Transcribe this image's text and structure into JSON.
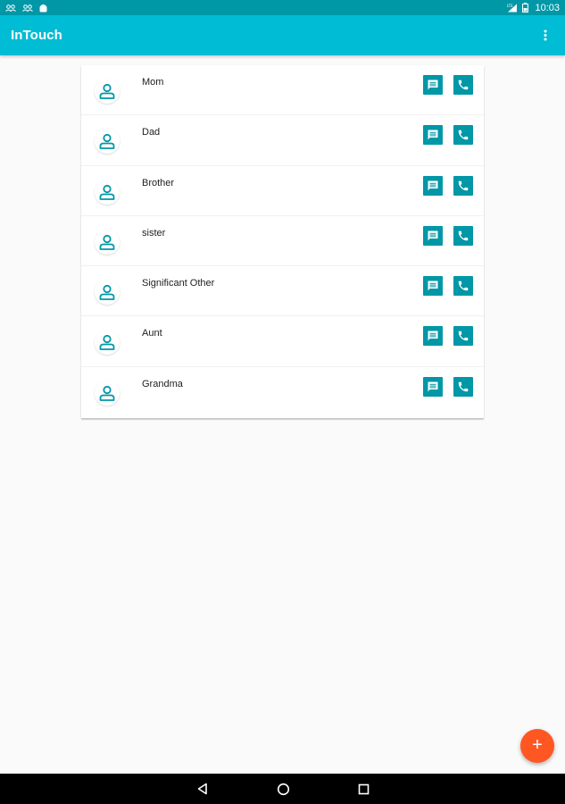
{
  "status_bar": {
    "time": "10:03",
    "network": "LTE",
    "left_icons": [
      "contacts-sync-icon",
      "contacts-sync-icon",
      "android-icon"
    ],
    "right_icons": [
      "signal-icon",
      "battery-icon"
    ]
  },
  "app_bar": {
    "title": "InTouch",
    "menu_icon": "overflow-menu-icon"
  },
  "contacts": [
    {
      "name": "Mom"
    },
    {
      "name": "Dad"
    },
    {
      "name": "Brother"
    },
    {
      "name": "sister"
    },
    {
      "name": "Significant Other"
    },
    {
      "name": "Aunt"
    },
    {
      "name": "Grandma"
    }
  ],
  "fab": {
    "label": "+",
    "icon": "add-icon"
  },
  "colors": {
    "status_bar": "#0097a7",
    "app_bar": "#00bcd4",
    "action_button": "#0097a7",
    "fab": "#ff5722",
    "background": "#fafafa"
  },
  "navigation": [
    "back-icon",
    "home-icon",
    "recents-icon"
  ]
}
